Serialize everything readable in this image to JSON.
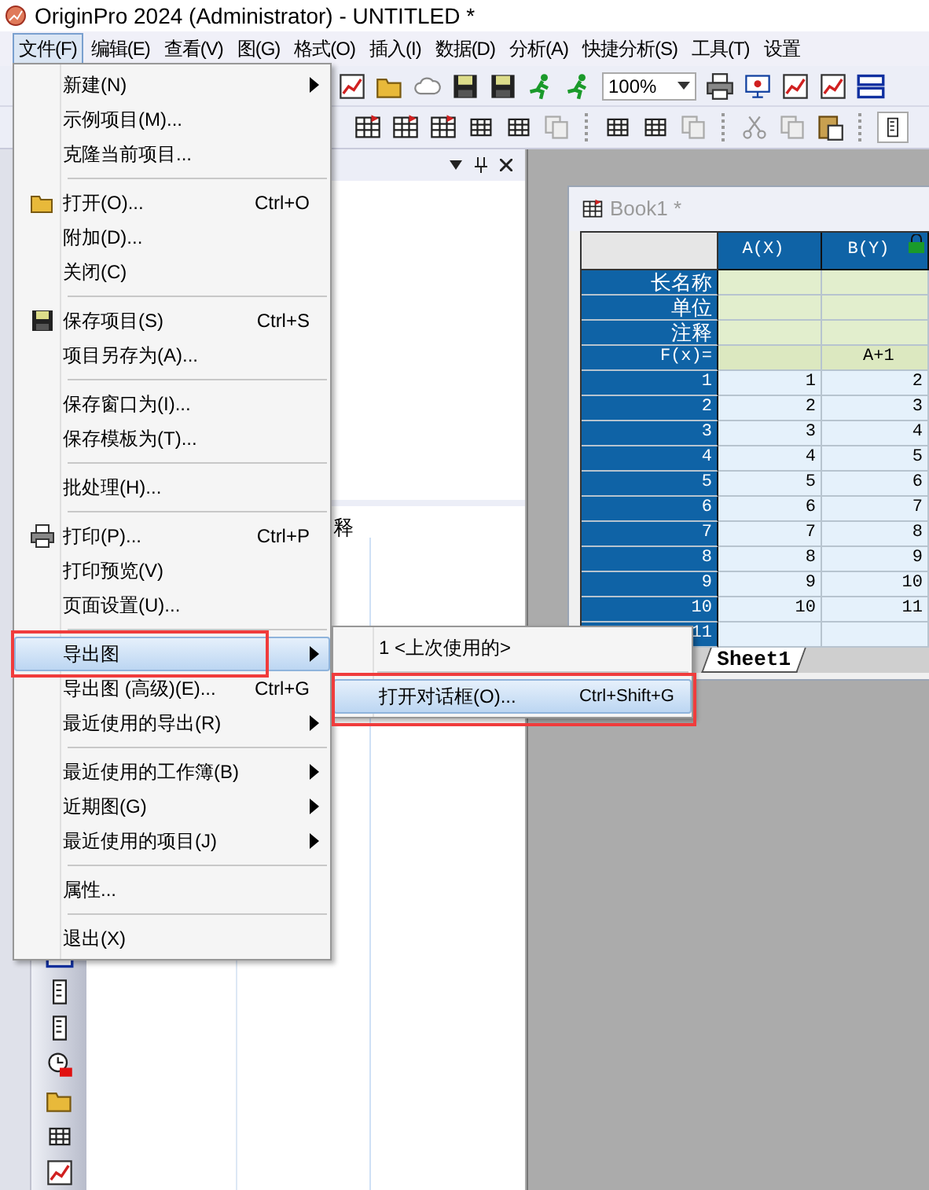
{
  "window": {
    "title": "OriginPro 2024 (Administrator) - UNTITLED *"
  },
  "menubar": [
    {
      "label": "文件(F)",
      "selected": true
    },
    {
      "label": "编辑(E)",
      "selected": false
    },
    {
      "label": "查看(V)",
      "selected": false
    },
    {
      "label": "图(G)",
      "selected": false
    },
    {
      "label": "格式(O)",
      "selected": false
    },
    {
      "label": "插入(I)",
      "selected": false
    },
    {
      "label": "数据(D)",
      "selected": false
    },
    {
      "label": "分析(A)",
      "selected": false
    },
    {
      "label": "快捷分析(S)",
      "selected": false
    },
    {
      "label": "工具(T)",
      "selected": false
    },
    {
      "label": "设置",
      "selected": false
    }
  ],
  "toolbar": {
    "zoom_value": "100%"
  },
  "file_menu": [
    {
      "kind": "item",
      "label": "新建(N)",
      "has_submenu": true,
      "selected": false
    },
    {
      "kind": "item",
      "label": "示例项目(M)...",
      "has_submenu": false,
      "selected": false
    },
    {
      "kind": "item",
      "label": "克隆当前项目...",
      "has_submenu": false,
      "selected": false
    },
    {
      "kind": "separator"
    },
    {
      "kind": "item",
      "label": "打开(O)...",
      "shortcut": "Ctrl+O",
      "has_submenu": false,
      "selected": false
    },
    {
      "kind": "item",
      "label": "附加(D)...",
      "has_submenu": false,
      "selected": false
    },
    {
      "kind": "item",
      "label": "关闭(C)",
      "has_submenu": false,
      "selected": false
    },
    {
      "kind": "separator"
    },
    {
      "kind": "item",
      "label": "保存项目(S)",
      "shortcut": "Ctrl+S",
      "has_submenu": false,
      "selected": false
    },
    {
      "kind": "item",
      "label": "项目另存为(A)...",
      "has_submenu": false,
      "selected": false
    },
    {
      "kind": "separator"
    },
    {
      "kind": "item",
      "label": "保存窗口为(I)...",
      "has_submenu": false,
      "selected": false
    },
    {
      "kind": "item",
      "label": "保存模板为(T)...",
      "has_submenu": false,
      "selected": false
    },
    {
      "kind": "separator"
    },
    {
      "kind": "item",
      "label": "批处理(H)...",
      "has_submenu": false,
      "selected": false
    },
    {
      "kind": "separator"
    },
    {
      "kind": "item",
      "label": "打印(P)...",
      "shortcut": "Ctrl+P",
      "has_submenu": false,
      "selected": false
    },
    {
      "kind": "item",
      "label": "打印预览(V)",
      "has_submenu": false,
      "selected": false
    },
    {
      "kind": "item",
      "label": "页面设置(U)...",
      "has_submenu": false,
      "selected": false
    },
    {
      "kind": "separator"
    },
    {
      "kind": "item",
      "label": "导出图",
      "has_submenu": true,
      "selected": true,
      "annotated": true
    },
    {
      "kind": "item",
      "label": "导出图 (高级)(E)...",
      "shortcut": "Ctrl+G",
      "has_submenu": false,
      "selected": false
    },
    {
      "kind": "item",
      "label": "最近使用的导出(R)",
      "has_submenu": true,
      "selected": false
    },
    {
      "kind": "separator"
    },
    {
      "kind": "item",
      "label": "最近使用的工作簿(B)",
      "has_submenu": true,
      "selected": false
    },
    {
      "kind": "item",
      "label": "近期图(G)",
      "has_submenu": true,
      "selected": false
    },
    {
      "kind": "item",
      "label": "最近使用的项目(J)",
      "has_submenu": true,
      "selected": false
    },
    {
      "kind": "separator"
    },
    {
      "kind": "item",
      "label": "属性...",
      "has_submenu": false,
      "selected": false
    },
    {
      "kind": "separator"
    },
    {
      "kind": "item",
      "label": "退出(X)",
      "has_submenu": false,
      "selected": false
    }
  ],
  "export_submenu": [
    {
      "kind": "item",
      "label": "1 <上次使用的>",
      "selected": false
    },
    {
      "kind": "separator"
    },
    {
      "kind": "item",
      "label": "打开对话框(O)...",
      "shortcut": "Ctrl+Shift+G",
      "selected": true,
      "annotated": true
    }
  ],
  "explorer": {
    "lower_pane_text": "释"
  },
  "workbook": {
    "title": "Book1 *",
    "columns": [
      "A(X)",
      "B(Y)"
    ],
    "label_rows": [
      {
        "label": "长名称"
      },
      {
        "label": "单位"
      },
      {
        "label": "注释"
      }
    ],
    "formula_row": {
      "label": "F(x)=",
      "column_2": "A+1"
    },
    "rows": [
      {
        "index": "1",
        "values": [
          "1",
          "2"
        ]
      },
      {
        "index": "2",
        "values": [
          "2",
          "3"
        ]
      },
      {
        "index": "3",
        "values": [
          "3",
          "4"
        ]
      },
      {
        "index": "4",
        "values": [
          "4",
          "5"
        ]
      },
      {
        "index": "5",
        "values": [
          "5",
          "6"
        ]
      },
      {
        "index": "6",
        "values": [
          "6",
          "7"
        ]
      },
      {
        "index": "7",
        "values": [
          "7",
          "8"
        ]
      },
      {
        "index": "8",
        "values": [
          "8",
          "9"
        ]
      },
      {
        "index": "9",
        "values": [
          "9",
          "10"
        ]
      },
      {
        "index": "10",
        "values": [
          "10",
          "11"
        ]
      },
      {
        "index": "11",
        "values": []
      }
    ],
    "sheet_tab": "Sheet1"
  }
}
